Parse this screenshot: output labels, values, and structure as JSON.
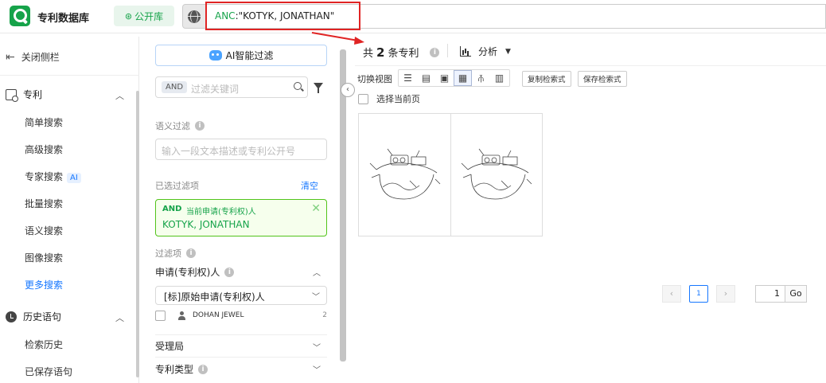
{
  "app": {
    "title": "专利数据库",
    "library_label": "公开库"
  },
  "search": {
    "field": "ANC",
    "query": ":\"KOTYK, JONATHAN\""
  },
  "sidebar": {
    "close_label": "关闭侧栏",
    "patent_section": "专利",
    "items": [
      "简单搜索",
      "高级搜索",
      "专家搜索",
      "批量搜索",
      "语义搜索",
      "图像搜索",
      "更多搜索"
    ],
    "expert_tag": "AI",
    "history_section": "历史语句",
    "history_items": [
      "检索历史",
      "已保存语句"
    ]
  },
  "filters": {
    "ai_filter_label": "AI智能过滤",
    "and_chip": "AND",
    "keyword_placeholder": "过滤关键词",
    "semantic_label": "语义过滤",
    "semantic_placeholder": "输入一段文本描述或专利公开号",
    "selected_label": "已选过滤项",
    "clear_label": "清空",
    "chosen": {
      "op": "AND",
      "field": "当前申请(专利权)人",
      "value": "KOTYK, JONATHAN"
    },
    "filter_items_label": "过滤项",
    "applicant_group": "申请(专利权)人",
    "applicant_select": "[标]原始申请(专利权)人",
    "applicant_option": {
      "name": "DOHAN JEWEL",
      "count": "2"
    },
    "office_group": "受理局",
    "type_group": "专利类型"
  },
  "results": {
    "prefix": "共",
    "count": "2",
    "suffix": "条专利",
    "analysis_label": "分析",
    "view_switch_label": "切换视图",
    "copy_query_label": "复制检索式",
    "save_query_label": "保存检索式",
    "select_page_label": "选择当前页"
  },
  "pager": {
    "page": "1",
    "goto_value": "1",
    "go_label": "Go"
  },
  "colors": {
    "accent_green": "#16a34a",
    "link_blue": "#1677ff",
    "highlight_red": "#e02424"
  }
}
